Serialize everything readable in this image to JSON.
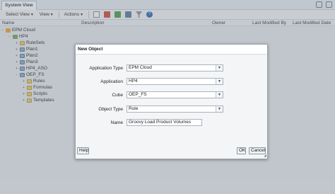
{
  "tab": {
    "title": "System View"
  },
  "toolbar": {
    "select_view": "Select View",
    "view": "View",
    "actions": "Actions"
  },
  "columns": [
    "Name",
    "Description",
    "Owner",
    "Last Modified By",
    "Last Modified Date"
  ],
  "tree": [
    {
      "label": "EPM Cloud",
      "icon": "cloud-icon",
      "toggle": "−"
    },
    {
      "label": "HP4",
      "icon": "application-icon",
      "toggle": "−"
    },
    {
      "label": "RuleSets",
      "icon": "folder-icon",
      "toggle": "+"
    },
    {
      "label": "Plan1",
      "icon": "cube-icon",
      "toggle": "+"
    },
    {
      "label": "Plan2",
      "icon": "cube-icon",
      "toggle": "+"
    },
    {
      "label": "Plan3",
      "icon": "cube-icon",
      "toggle": "+"
    },
    {
      "label": "HP4_ASO",
      "icon": "cube-icon",
      "toggle": "+"
    },
    {
      "label": "OEP_FS",
      "icon": "cube-icon",
      "toggle": "−"
    },
    {
      "label": "Rules",
      "icon": "folder-icon",
      "toggle": "+"
    },
    {
      "label": "Formulas",
      "icon": "folder-icon",
      "toggle": "+"
    },
    {
      "label": "Scripts",
      "icon": "folder-icon",
      "toggle": "+"
    },
    {
      "label": "Templates",
      "icon": "folder-icon",
      "toggle": "+"
    }
  ],
  "dialog": {
    "title": "New Object",
    "fields": {
      "application_type": {
        "label": "Application Type",
        "value": "EPM Cloud"
      },
      "application": {
        "label": "Application",
        "value": "HP4"
      },
      "cube": {
        "label": "Cube",
        "value": "OEP_FS"
      },
      "object_type": {
        "label": "Object Type",
        "value": "Rule"
      },
      "name": {
        "label": "Name",
        "value": "Groovy Load Product Volumes"
      }
    },
    "help": "Help",
    "ok": "OK",
    "cancel": "Cancel"
  },
  "colors": {
    "toolbar_bg": "#f4f6f8",
    "tree_bg": "#e9ecee",
    "dialog_bg": "#f4f5f6",
    "accent": "#2a6bb0"
  }
}
